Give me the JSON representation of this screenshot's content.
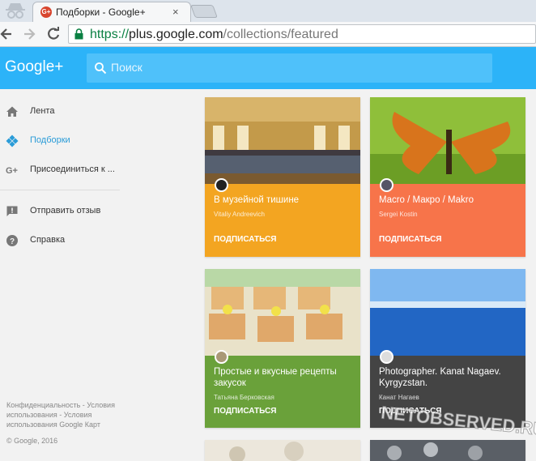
{
  "browser": {
    "tab_title": "Подборки - Google+",
    "tab_favicon": "G+",
    "tab_close": "×",
    "url_protocol": "https://",
    "url_host": "plus.google.com",
    "url_path": "/collections/featured"
  },
  "header": {
    "logo": "Google+",
    "search_placeholder": "Поиск",
    "color": "#2cb3f8"
  },
  "sidebar": {
    "items": [
      {
        "label": "Лента",
        "icon": "home-icon"
      },
      {
        "label": "Подборки",
        "icon": "collections-icon",
        "active": true
      },
      {
        "label": "Присоединиться к ...",
        "icon": "google-plus-icon"
      },
      {
        "label": "Отправить отзыв",
        "icon": "feedback-icon"
      },
      {
        "label": "Справка",
        "icon": "help-icon"
      }
    ],
    "footer_links": "Конфиденциальность - Условия использования - Условия использования Google Карт",
    "copyright": "© Google, 2016"
  },
  "cards": [
    {
      "title": "В музейной тишине",
      "author": "Vitaliy Andreevich",
      "subscribe": "ПОДПИСАТЬСЯ",
      "color": "#f3a521"
    },
    {
      "title": "Macro / Макро / Makro",
      "author": "Sergei Kostin",
      "subscribe": "ПОДПИСАТЬСЯ",
      "color": "#f7744a"
    },
    {
      "title": "Простые и вкусные рецепты закусок",
      "author": "Татьяна Берковская",
      "subscribe": "ПОДПИСАТЬСЯ",
      "color": "#6aa13a"
    },
    {
      "title": "Photographer. Kanat Nagaev. Kyrgyzstan.",
      "author": "Канат Нагаев",
      "subscribe": "ПОДПИСАТЬСЯ",
      "color": "#444444"
    }
  ],
  "watermark": "NETOBSERVED.RU"
}
